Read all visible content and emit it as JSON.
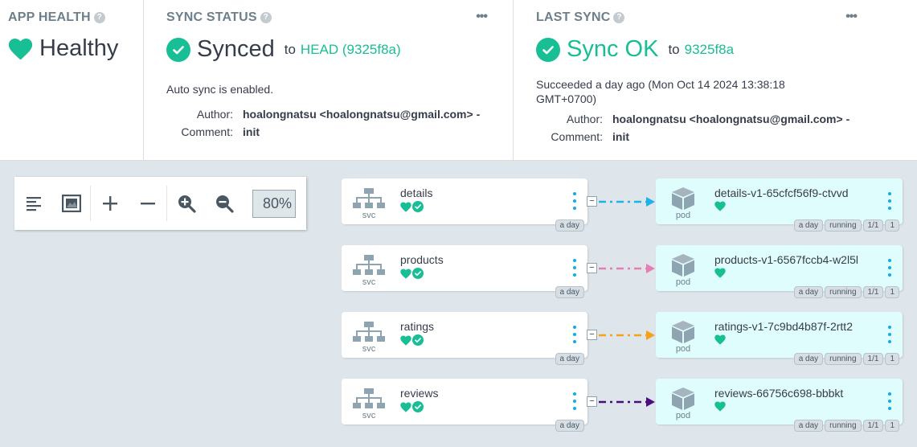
{
  "app_health": {
    "title": "APP HEALTH",
    "status": "Healthy"
  },
  "sync_status": {
    "title": "SYNC STATUS",
    "status": "Synced",
    "to_label": "to",
    "revision": "HEAD (9325f8a)",
    "auto_sync": "Auto sync is enabled.",
    "author_label": "Author:",
    "author": "hoalongnatsu <hoalongnatsu@gmail.com> -",
    "comment_label": "Comment:",
    "comment": "init"
  },
  "last_sync": {
    "title": "LAST SYNC",
    "status": "Sync OK",
    "to_label": "to",
    "revision": "9325f8a",
    "succeeded_line1": "Succeeded a day ago (Mon Oct 14 2024 13:38:18",
    "succeeded_line2": "GMT+0700)",
    "author_label": "Author:",
    "author": "hoalongnatsu <hoalongnatsu@gmail.com> -",
    "comment_label": "Comment:",
    "comment": "init"
  },
  "toolbar": {
    "zoom": "80%"
  },
  "graph": {
    "services": [
      {
        "name": "details",
        "kind": "svc",
        "age": "a day"
      },
      {
        "name": "products",
        "kind": "svc",
        "age": "a day"
      },
      {
        "name": "ratings",
        "kind": "svc",
        "age": "a day"
      },
      {
        "name": "reviews",
        "kind": "svc",
        "age": "a day"
      }
    ],
    "pods": [
      {
        "name": "details-v1-65cfcf56f9-ctvvd",
        "kind": "pod",
        "age": "a day",
        "state": "running",
        "ready": "1/1",
        "count": "1"
      },
      {
        "name": "products-v1-6567fccb4-w2l5l",
        "kind": "pod",
        "age": "a day",
        "state": "running",
        "ready": "1/1",
        "count": "1"
      },
      {
        "name": "ratings-v1-7c9bd4b87f-2rtt2",
        "kind": "pod",
        "age": "a day",
        "state": "running",
        "ready": "1/1",
        "count": "1"
      },
      {
        "name": "reviews-66756c698-bbbkt",
        "kind": "pod",
        "age": "a day",
        "state": "running",
        "ready": "1/1",
        "count": "1"
      }
    ],
    "collapse_symbol": "−",
    "edge_colors": [
      "#1eb2e8",
      "#e57fb3",
      "#f5a21a",
      "#4b0c80"
    ]
  },
  "colors": {
    "healthy": "#18be94",
    "link": "#18be94",
    "kebab": "#0dadea"
  }
}
